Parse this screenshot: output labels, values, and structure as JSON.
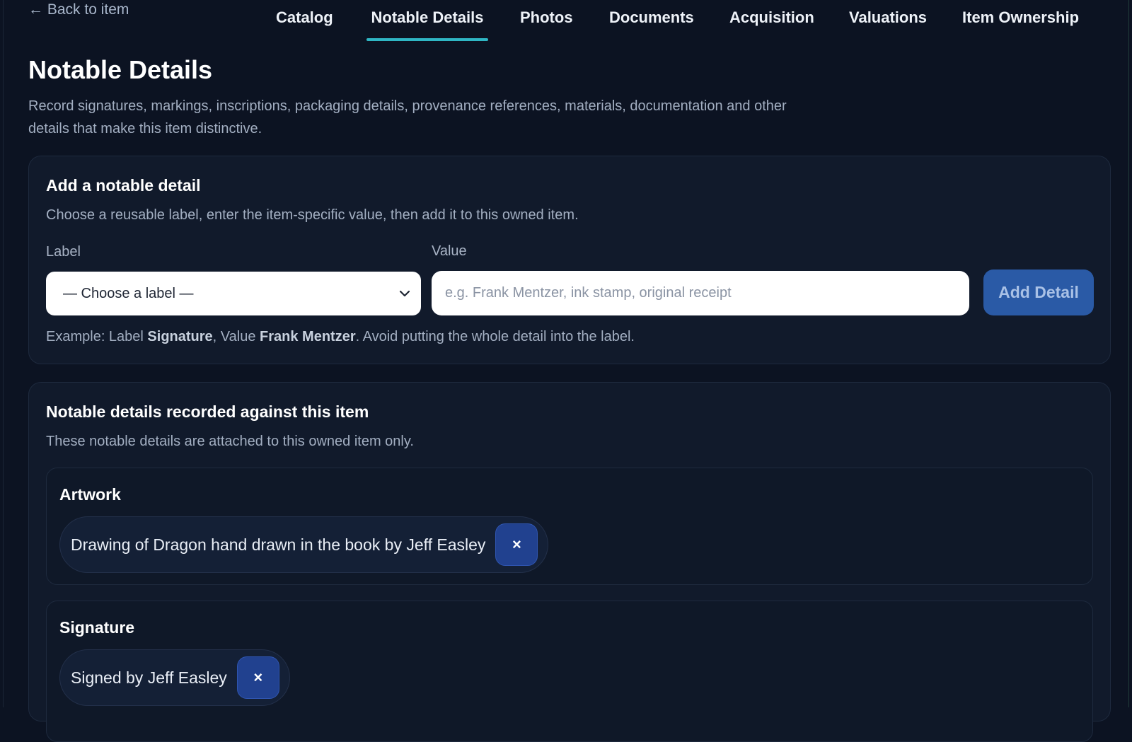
{
  "nav": {
    "back_label": "← Back to item",
    "tabs": [
      {
        "label": "Catalog"
      },
      {
        "label": "Notable Details",
        "active": true
      },
      {
        "label": "Photos"
      },
      {
        "label": "Documents"
      },
      {
        "label": "Acquisition"
      },
      {
        "label": "Valuations"
      },
      {
        "label": "Item Ownership"
      }
    ]
  },
  "page": {
    "title": "Notable Details",
    "description": "Record signatures, markings, inscriptions, packaging details, provenance references, materials, documentation and other details that make this item distinctive."
  },
  "add_form": {
    "title": "Add a notable detail",
    "subtitle": "Choose a reusable label, enter the item-specific value, then add it to this owned item.",
    "label_field_label": "Label",
    "label_select_value": "— Choose a label —",
    "value_field_label": "Value",
    "value_placeholder": "e.g. Frank Mentzer, ink stamp, original receipt",
    "add_button_label": "Add Detail",
    "example": {
      "prefix": "Example: Label ",
      "label_example": "Signature",
      "middle": ", Value ",
      "value_example": "Frank Mentzer",
      "suffix": ". Avoid putting the whole detail into the label."
    }
  },
  "recorded": {
    "title": "Notable details recorded against this item",
    "subtitle": "These notable details are attached to this owned item only.",
    "groups": [
      {
        "label": "Artwork",
        "values": [
          "Drawing of Dragon hand drawn in the book by Jeff Easley"
        ]
      },
      {
        "label": "Signature",
        "values": [
          "Signed by Jeff Easley"
        ]
      }
    ],
    "remove_glyph": "×"
  },
  "colors": {
    "background": "#0c1322",
    "card": "#111a2b",
    "active_tab_underline": "#2fb6c4",
    "primary_button": "#2a5aa6",
    "remove_button": "#21418f"
  }
}
